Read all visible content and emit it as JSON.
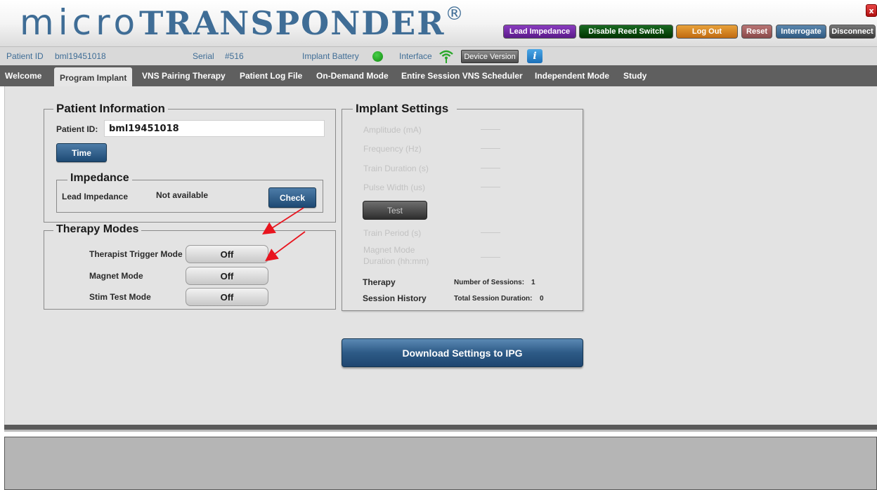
{
  "header": {
    "logo_micro": "micro",
    "logo_transponder": "TRANSPONDER",
    "logo_reg": "®",
    "buttons": {
      "lead_impedance": "Lead Impedance",
      "disable_reed_switch": "Disable Reed Switch",
      "log_out": "Log Out",
      "reset": "Reset",
      "interrogate": "Interrogate",
      "disconnect": "Disconnect",
      "close": "x"
    },
    "colors": {
      "lead_impedance": "#6a2a9e",
      "disable_reed_switch": "#0f4f17",
      "log_out": "#d9861f",
      "reset": "#a05c5c",
      "interrogate": "#3d6d96",
      "disconnect": "#4a4a4a",
      "close": "#cc2222"
    }
  },
  "infobar": {
    "patient_id_label": "Patient ID",
    "patient_id_value": "bml19451018",
    "serial_label": "Serial",
    "serial_value": "#516",
    "implant_battery_label": "Implant Battery",
    "battery_status_color": "#2aa82a",
    "interface_label": "Interface",
    "interface_icon": "wifi-icon",
    "device_version_button": "Device Version",
    "info_icon": "i"
  },
  "nav": {
    "tabs": [
      {
        "label": "Welcome",
        "active": false
      },
      {
        "label": "Program Implant",
        "active": true
      },
      {
        "label": "VNS Pairing Therapy",
        "active": false
      },
      {
        "label": "Patient Log File",
        "active": false
      },
      {
        "label": "On-Demand Mode",
        "active": false
      },
      {
        "label": "Entire Session VNS Scheduler",
        "active": false
      },
      {
        "label": "Independent Mode",
        "active": false
      },
      {
        "label": "Study",
        "active": false
      }
    ]
  },
  "patient_info": {
    "title": "Patient Information",
    "patient_id_label": "Patient ID:",
    "patient_id_value": "bml19451018",
    "time_button": "Time"
  },
  "impedance": {
    "title": "Impedance",
    "lead_label": "Lead Impedance",
    "lead_value": "Not available",
    "check_button": "Check"
  },
  "therapy_modes": {
    "title": "Therapy Modes",
    "modes": [
      {
        "label": "Therapist Trigger Mode",
        "value": "Off"
      },
      {
        "label": "Magnet Mode",
        "value": "Off"
      },
      {
        "label": "Stim Test Mode",
        "value": "Off"
      }
    ]
  },
  "implant_settings": {
    "title": "Implant Settings",
    "fields": [
      {
        "label": "Amplitude (mA)"
      },
      {
        "label": "Frequency (Hz)"
      },
      {
        "label": "Train Duration (s)"
      },
      {
        "label": "Pulse Width (us)"
      }
    ],
    "test_button": "Test",
    "train_period_label": "Train Period (s)",
    "magnet_mode_label_line1": "Magnet Mode",
    "magnet_mode_label_line2": "Duration (hh:mm)",
    "therapy_label": "Therapy",
    "session_history_label": "Session History",
    "number_of_sessions_label": "Number of Sessions:",
    "number_of_sessions_value": "1",
    "total_session_duration_label": "Total Session Duration:",
    "total_session_duration_value": "0"
  },
  "download_button": "Download Settings to IPG",
  "annotation_color": "#e8141e"
}
